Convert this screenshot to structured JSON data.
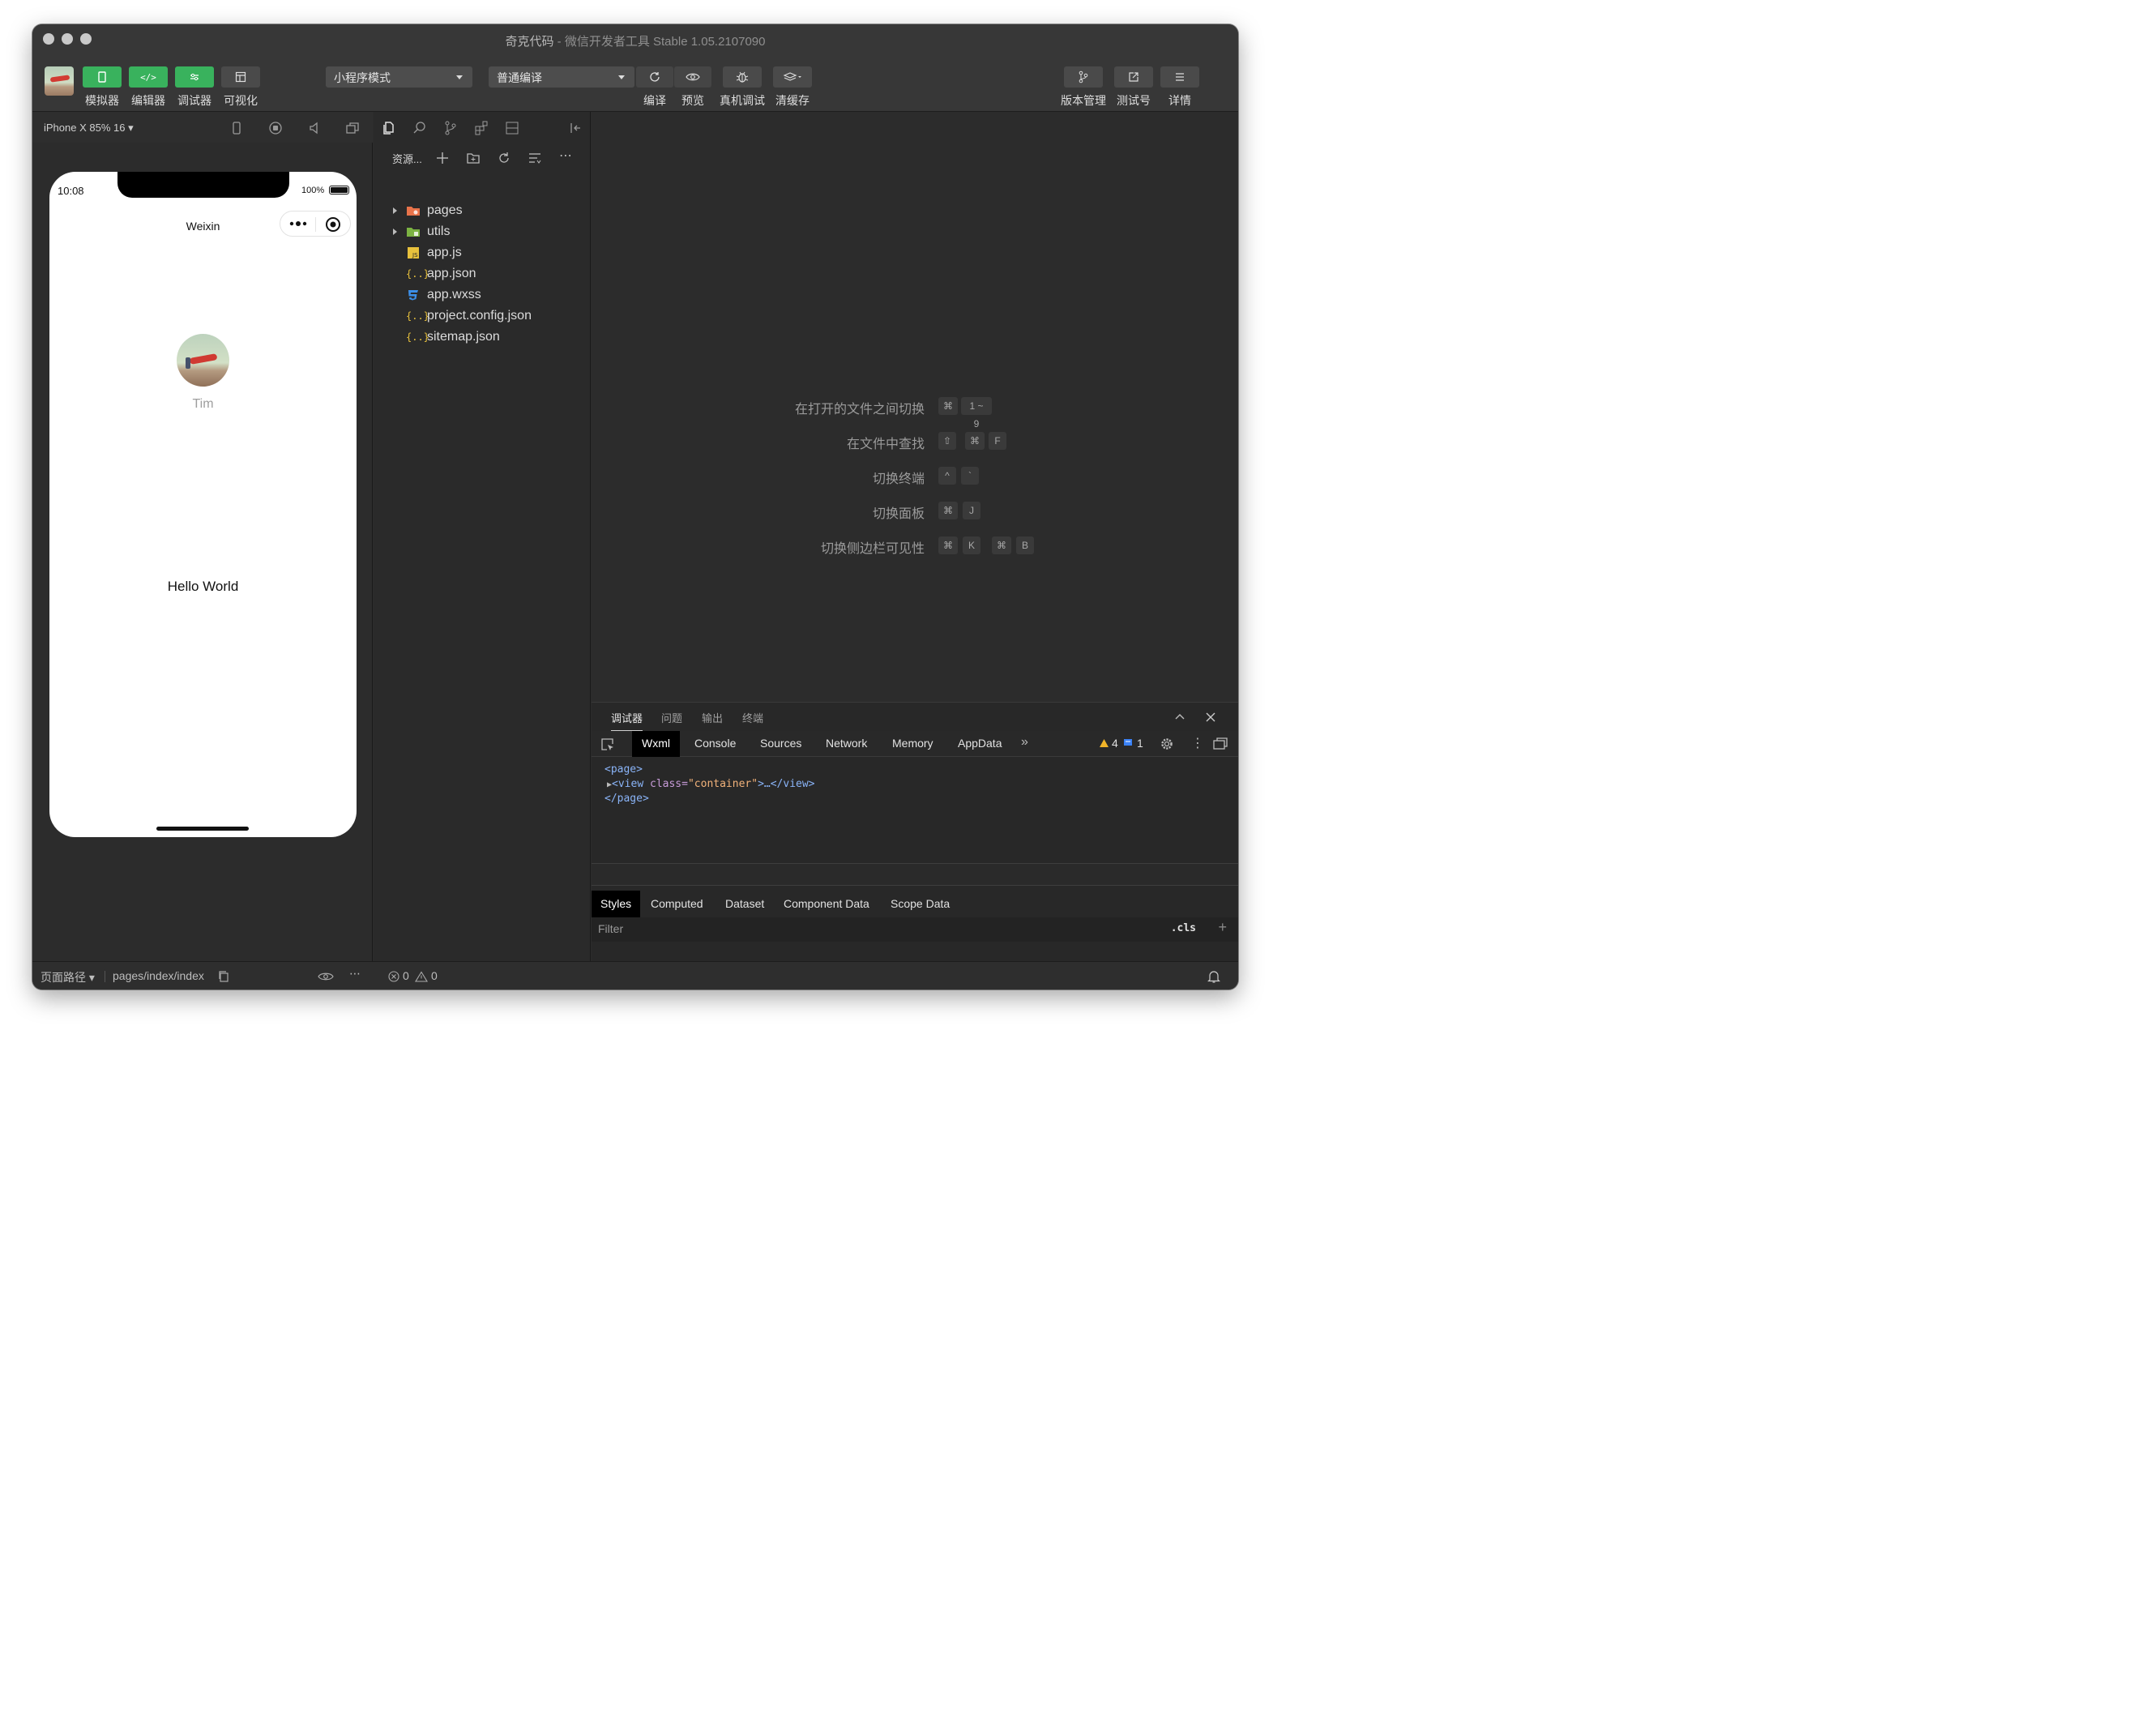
{
  "window": {
    "title": "奇克代码",
    "subtitle": " - 微信开发者工具 Stable 1.05.2107090"
  },
  "toolbar": {
    "left_buttons": [
      {
        "label": "模拟器",
        "icon": "phone-icon"
      },
      {
        "label": "编辑器",
        "icon": "code-icon"
      },
      {
        "label": "调试器",
        "icon": "sliders-icon"
      },
      {
        "label": "可视化",
        "icon": "layout-icon"
      }
    ],
    "mode_select": "小程序模式",
    "compile_select": "普通编译",
    "action_buttons": [
      {
        "label": "编译",
        "icon": "refresh-icon"
      },
      {
        "label": "预览",
        "icon": "eye-icon"
      },
      {
        "label": "真机调试",
        "icon": "bug-icon"
      },
      {
        "label": "清缓存",
        "icon": "layers-icon"
      }
    ],
    "right_buttons": [
      {
        "label": "版本管理",
        "icon": "branch-icon"
      },
      {
        "label": "测试号",
        "icon": "external-link-icon"
      },
      {
        "label": "详情",
        "icon": "menu-icon"
      }
    ]
  },
  "simulator": {
    "device": "iPhone X 85% 16 ▾",
    "status_time": "10:08",
    "battery": "100%",
    "nav_title": "Weixin",
    "nickname": "Tim",
    "content": "Hello World"
  },
  "explorer": {
    "title": "资源...",
    "files": [
      {
        "name": "pages",
        "type": "folder",
        "icon": "folder-pages-icon",
        "color": "#e8734a"
      },
      {
        "name": "utils",
        "type": "folder",
        "icon": "folder-utils-icon",
        "color": "#7cb342"
      },
      {
        "name": "app.js",
        "type": "file",
        "icon": "js-file-icon",
        "color": "#e8c13c"
      },
      {
        "name": "app.json",
        "type": "file",
        "icon": "json-file-icon",
        "color": "#e8c13c"
      },
      {
        "name": "app.wxss",
        "type": "file",
        "icon": "css-file-icon",
        "color": "#3c8fe8"
      },
      {
        "name": "project.config.json",
        "type": "file",
        "icon": "json-file-icon",
        "color": "#e8c13c"
      },
      {
        "name": "sitemap.json",
        "type": "file",
        "icon": "json-file-icon",
        "color": "#e8c13c"
      }
    ]
  },
  "editor_hints": [
    {
      "text": "在打开的文件之间切换",
      "keys": [
        "⌘",
        "1 ~ 9"
      ]
    },
    {
      "text": "在文件中查找",
      "keys": [
        "⇧",
        "⌘",
        "F"
      ]
    },
    {
      "text": "切换终端",
      "keys": [
        "^",
        "`"
      ]
    },
    {
      "text": "切换面板",
      "keys": [
        "⌘",
        "J"
      ]
    },
    {
      "text": "切换侧边栏可见性",
      "keys": [
        "⌘",
        "K",
        "⌘",
        "B"
      ]
    }
  ],
  "debugger": {
    "panel_tabs": [
      "调试器",
      "问题",
      "输出",
      "终端"
    ],
    "devtools_tabs": [
      "Wxml",
      "Console",
      "Sources",
      "Network",
      "Memory",
      "AppData"
    ],
    "warnings": "4",
    "infos": "1",
    "wxml": {
      "line1": "<page>",
      "line2_tag": "<view ",
      "line2_attr": "class=",
      "line2_val": "\"container\"",
      "line2_rest": ">…</view>",
      "line3": "</page>"
    },
    "style_tabs": [
      "Styles",
      "Computed",
      "Dataset",
      "Component Data",
      "Scope Data"
    ],
    "filter_placeholder": "Filter",
    "cls_label": ".cls"
  },
  "statusbar": {
    "page_path_label": "页面路径 ▾",
    "page_path": "pages/index/index",
    "errors": "0",
    "warnings": "0"
  }
}
